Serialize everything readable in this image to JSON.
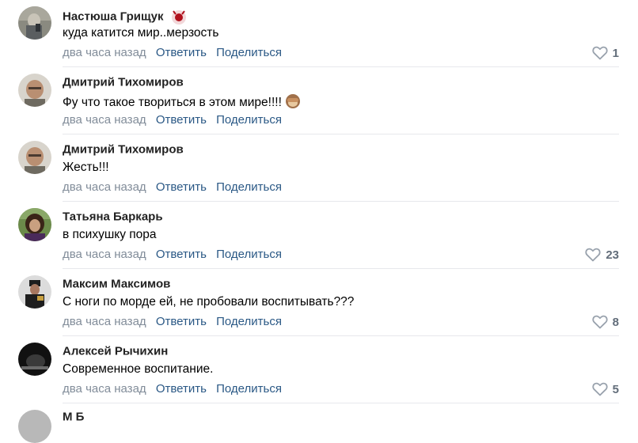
{
  "comments": [
    {
      "author": "Настюша Грищук",
      "text": "куда катится мир..мерзость",
      "time": "два часа назад",
      "reply_label": "Ответить",
      "share_label": "Поделиться",
      "likes": "1",
      "badge_icon": "sticker-icon",
      "avatar_colors": [
        "#8a8a80",
        "#c9c4b8",
        "#5a5e60"
      ]
    },
    {
      "author": "Дмитрий Тихомиров",
      "text": "Фу что такое твориться в этом мире!!!!",
      "emoji_icon": "see-no-evil-monkey-icon",
      "time": "два часа назад",
      "reply_label": "Ответить",
      "share_label": "Поделиться",
      "likes": "",
      "avatar_colors": [
        "#d8d4cc",
        "#b98f72",
        "#6e6a60"
      ]
    },
    {
      "author": "Дмитрий Тихомиров",
      "text": "Жесть!!!",
      "time": "два часа назад",
      "reply_label": "Ответить",
      "share_label": "Поделиться",
      "likes": "",
      "avatar_colors": [
        "#d8d4cc",
        "#b98f72",
        "#6e6a60"
      ]
    },
    {
      "author": "Татьяна Баркарь",
      "text": "в психушку пора",
      "time": "два часа назад",
      "reply_label": "Ответить",
      "share_label": "Поделиться",
      "likes": "23",
      "avatar_colors": [
        "#6b8a4a",
        "#3a2418",
        "#c9a080"
      ]
    },
    {
      "author": "Максим Максимов",
      "text": "С ноги по морде ей, не пробовали воспитывать???",
      "time": "два часа назад",
      "reply_label": "Ответить",
      "share_label": "Поделиться",
      "likes": "8",
      "avatar_colors": [
        "#dcdcdc",
        "#1e1e1e",
        "#a87860"
      ]
    },
    {
      "author": "Алексей Рычихин",
      "text": "Современное воспитание.",
      "time": "два часа назад",
      "reply_label": "Ответить",
      "share_label": "Поделиться",
      "likes": "5",
      "avatar_colors": [
        "#111111",
        "#3a3a3a",
        "#6a6a6a"
      ]
    }
  ],
  "partial_comment": {
    "author": "М Б"
  },
  "colors": {
    "link": "#2a5885",
    "time": "#818c99",
    "likes": "#626d7a",
    "divider": "#e7e8ec"
  }
}
